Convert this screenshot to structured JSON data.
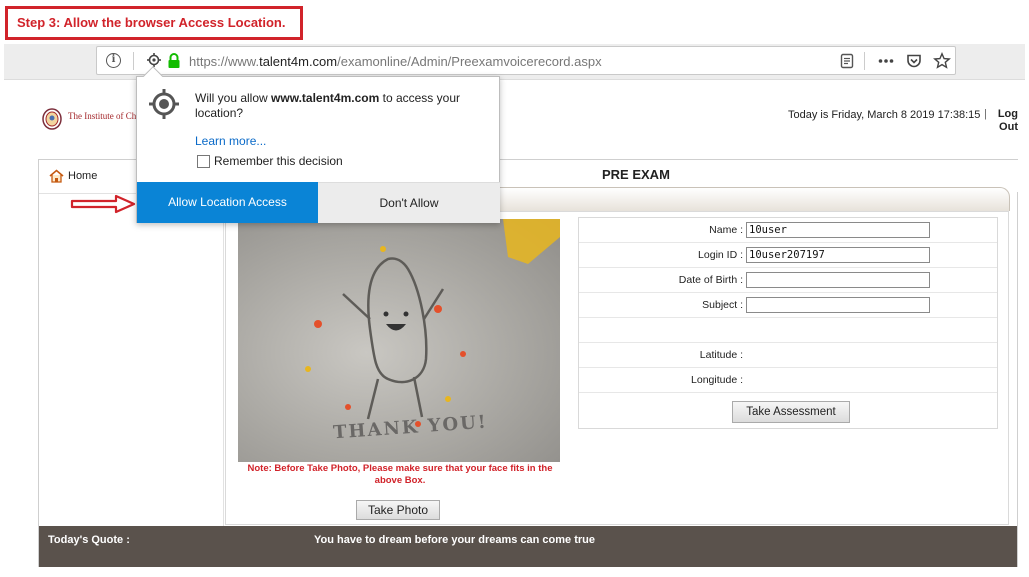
{
  "step_banner": "Step 3: Allow the browser Access Location.",
  "browser": {
    "url_prefix": "https://www.",
    "url_domain": "talent4m.com",
    "url_path": "/examonline/Admin/Preexamvoicerecord.aspx",
    "toolbar_icons": [
      "reader-view-icon",
      "more-icon",
      "pocket-icon",
      "bookmark-star-icon"
    ]
  },
  "header": {
    "logo_text": "The Institute of Charter",
    "date_text": "Today is Friday, March 8 2019 17:38:15",
    "separator": "|",
    "logout": "Log Out"
  },
  "nav": {
    "home": "Home"
  },
  "page_title": "PRE EXAM",
  "photo": {
    "caption": "THANK YOU!"
  },
  "note": "Note: Before Take Photo, Please make sure that your face fits in the above Box.",
  "take_photo": "Take Photo",
  "form": {
    "name_label": "Name :",
    "name_value": "10user",
    "login_label": "Login ID :",
    "login_value": "10user207197",
    "dob_label": "Date of Birth :",
    "dob_value": "",
    "subject_label": "Subject :",
    "subject_value": "",
    "latitude_label": "Latitude :",
    "longitude_label": "Longitude :",
    "submit": "Take Assessment"
  },
  "quote": {
    "label": "Today's Quote :",
    "text": "You have to dream before your dreams can come true"
  },
  "popup": {
    "message_pre": "Will you allow ",
    "message_domain": "www.talent4m.com",
    "message_post": " to access your location?",
    "learn_more": "Learn more...",
    "remember": "Remember this decision",
    "allow": "Allow Location Access",
    "deny": "Don't Allow"
  },
  "colors": {
    "banner_red": "#d1232a",
    "allow_blue": "#0a84d6",
    "quote_bar": "#5a524c",
    "lock_green": "#12bc00"
  }
}
